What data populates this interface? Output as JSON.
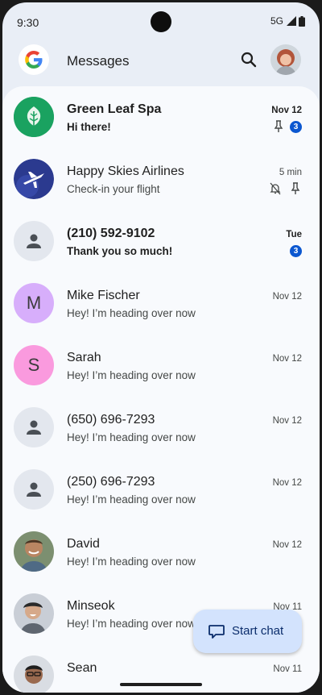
{
  "status_bar": {
    "time": "9:30",
    "network": "5G"
  },
  "app_bar": {
    "title": "Messages"
  },
  "conversations": [
    {
      "name": "Green Leaf Spa",
      "message": "Hi there!",
      "date": "Nov 12",
      "unread_count": "3",
      "bold": true,
      "avatar": "leaf-logo-icon",
      "pinned": true
    },
    {
      "name": "Happy Skies Airlines",
      "message": "Check-in your flight",
      "date": "5 min",
      "bold": false,
      "avatar": "plane-logo-icon",
      "muted": true,
      "pinned": true
    },
    {
      "name": "(210) 592-9102",
      "message": "Thank you so much!",
      "date": "Tue",
      "unread_count": "3",
      "bold": true,
      "avatar": "person-icon"
    },
    {
      "name": "Mike Fischer",
      "message": "Hey! I’m heading over now",
      "date": "Nov 12",
      "avatar_letter": "M",
      "avatar_color": "#d7aefb"
    },
    {
      "name": "Sarah",
      "message": "Hey! I’m heading over now",
      "date": "Nov 12",
      "avatar_letter": "S",
      "avatar_color": "#fa9ade"
    },
    {
      "name": "(650) 696-7293",
      "message": "Hey! I’m heading over now",
      "date": "Nov 12",
      "avatar": "person-icon"
    },
    {
      "name": "(250) 696-7293",
      "message": "Hey! I’m heading over now",
      "date": "Nov 12",
      "avatar": "person-icon"
    },
    {
      "name": "David",
      "message": "Hey! I’m heading over now",
      "date": "Nov 12",
      "avatar": "photo"
    },
    {
      "name": "Minseok",
      "message": "Hey! I’m heading over now",
      "date": "Nov 11",
      "avatar": "photo"
    },
    {
      "name": "Sean",
      "message": "",
      "date": "Nov 11",
      "avatar": "photo"
    }
  ],
  "fab": {
    "label": "Start chat"
  },
  "colors": {
    "accent": "#0b57d0",
    "fab_bg": "#d3e3fd",
    "list_bg": "#f8fafd",
    "header_bg": "#e9eef6"
  }
}
